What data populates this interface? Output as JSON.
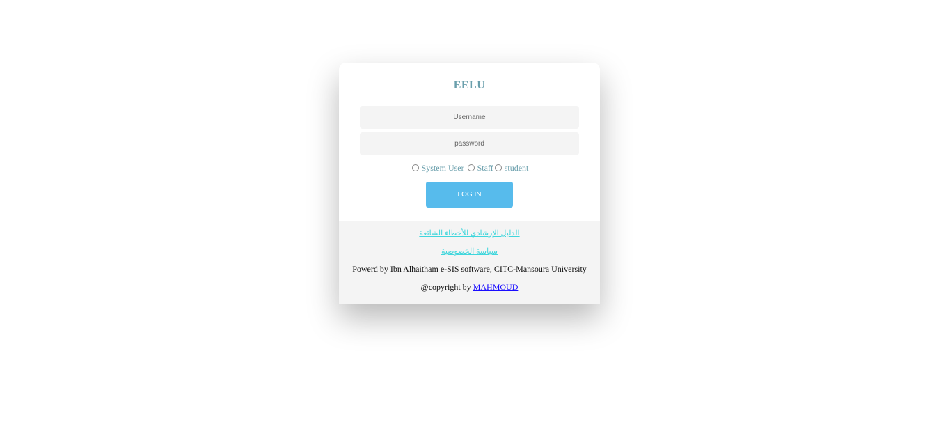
{
  "title": "EELU",
  "username_placeholder": "Username",
  "password_placeholder": "password",
  "roles": [
    "System User",
    "Staff",
    "student"
  ],
  "login_label": "LOG IN",
  "footer": {
    "link_guide": "الدليل الإرشادي للأخطاء الشائعة",
    "link_privacy": "سياسة الخصوصية",
    "powered": "Powerd by Ibn Alhaitham e-SIS software, CITC-Mansoura University",
    "copyright_prefix": "@copyright by ",
    "copyright_author": "MAHMOUD"
  }
}
